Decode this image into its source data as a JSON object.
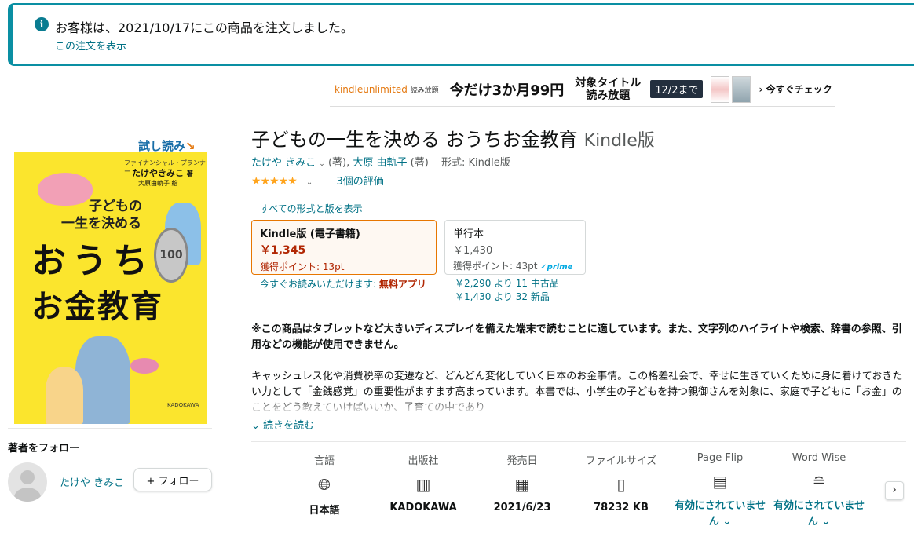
{
  "notice": {
    "text": "お客様は、2021/10/17にこの商品を注文しました。",
    "link": "この注文を表示"
  },
  "promo": {
    "brand": "kindleunlimited",
    "brand_sub": "読み放題",
    "headline": "今だけ3か月99円",
    "target_line1": "対象タイトル",
    "target_line2": "読み放題",
    "deadline": "12/2まで",
    "cta": "今すぐチェック"
  },
  "left": {
    "try_read": "試し読み",
    "cover": {
      "author_title": "ファイナンシャル・プランナー",
      "author": "たけやきみこ",
      "author_suffix": "著",
      "illustrator": "大原由軌子",
      "illustrator_suffix": "絵",
      "title_line1": "子どもの",
      "title_line2": "一生を決める",
      "title_line3": "おうち",
      "title_line4": "お金教育",
      "coin_value": "100",
      "publisher": "KADOKAWA"
    },
    "follow_heading": "著者をフォロー",
    "author_name": "たけや きみこ",
    "follow_button": "+ フォロー"
  },
  "product": {
    "title": "子どもの一生を決める おうちお金教育",
    "format": "Kindle版",
    "author1": "たけや きみこ",
    "author1_role": "(著),",
    "author2": "大原 由軌子",
    "author2_role": "(著)",
    "format_label": "形式: Kindle版",
    "stars": "★★★★★",
    "rating_count": "3個の評価",
    "all_formats": "すべての形式と版を表示",
    "formats": [
      {
        "name": "Kindle版 (電子書籍)",
        "price": "￥1,345",
        "points": "獲得ポイント: 13pt"
      },
      {
        "name": "単行本",
        "price": "￥1,430",
        "points": "獲得ポイント: 43pt",
        "badge": "prime"
      }
    ],
    "read_now": "今すぐお読みいただけます:",
    "free_app": "無料アプリ",
    "used_line": "￥2,290 より 11 中古品",
    "new_line": "￥1,430 より 32 新品",
    "bold_notice": "※この商品はタブレットなど大きいディスプレイを備えた端末で読むことに適しています。また、文字列のハイライトや検索、辞書の参照、引用などの機能が使用できません。",
    "description": "キャッシュレス化や消費税率の変遷など、どんどん変化していく日本のお金事情。この格差社会で、幸せに生きていくために身に着けておきたい力として「金銭感覚」の重要性がますます高まっています。本書では、小学生の子どもを持つ親御さんを対象に、家庭で子どもに「お金」のことをどう教えていけばいいか、子育ての中であり",
    "read_more": "続きを読む"
  },
  "details": [
    {
      "label": "言語",
      "icon": "globe-icon",
      "value": "日本語"
    },
    {
      "label": "出版社",
      "icon": "building-icon",
      "value": "KADOKAWA"
    },
    {
      "label": "発売日",
      "icon": "calendar-icon",
      "value": "2021/6/23"
    },
    {
      "label": "ファイルサイズ",
      "icon": "file-icon",
      "value": "78232 KB"
    },
    {
      "label": "Page Flip",
      "icon": "page-flip-icon",
      "value": "有効にされていません"
    },
    {
      "label": "Word Wise",
      "icon": "word-wise-icon",
      "value": "有効にされていません"
    }
  ],
  "colors": {
    "link": "#007185",
    "price": "#b12704",
    "star": "#ffa41c",
    "notice_border": "#0a8fa3",
    "selected_border": "#e77600"
  }
}
